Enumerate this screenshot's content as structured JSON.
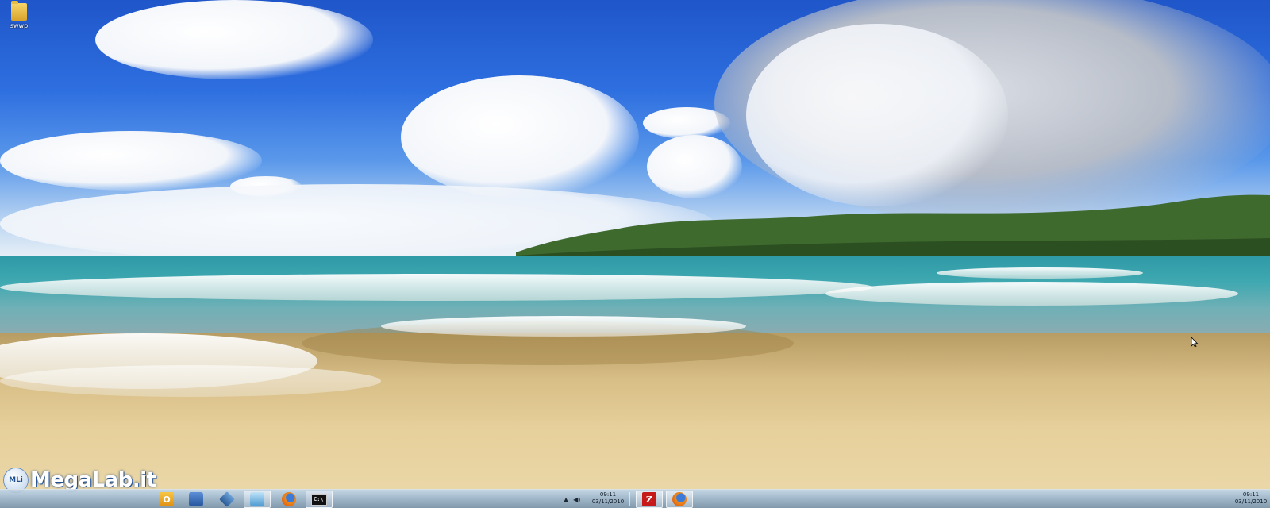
{
  "desktop": {
    "icons": [
      {
        "label": "swwp",
        "icon": "folder-icon"
      }
    ]
  },
  "watermark": {
    "badge": "MLi",
    "text": "MegaLab.it"
  },
  "taskbar": {
    "pinned": [
      {
        "name": "outlook",
        "icon": "outlook-icon",
        "glyph": "O"
      },
      {
        "name": "remote-desktop",
        "icon": "remote-desktop-icon",
        "glyph": ""
      },
      {
        "name": "virtualbox",
        "icon": "virtualbox-icon",
        "glyph": ""
      },
      {
        "name": "window",
        "icon": "window-icon",
        "glyph": ""
      },
      {
        "name": "firefox",
        "icon": "firefox-icon",
        "glyph": ""
      },
      {
        "name": "command-prompt",
        "icon": "command-prompt-icon",
        "glyph": "C:\\"
      }
    ],
    "tray": {
      "clock_time": "09:11",
      "clock_date": "03/11/2010"
    },
    "secondary": [
      {
        "name": "filezilla",
        "icon": "filezilla-icon",
        "glyph": "Z"
      },
      {
        "name": "firefox",
        "icon": "firefox-icon",
        "glyph": ""
      }
    ],
    "right_clock": {
      "time": "09:11",
      "date": "03/11/2010"
    }
  }
}
